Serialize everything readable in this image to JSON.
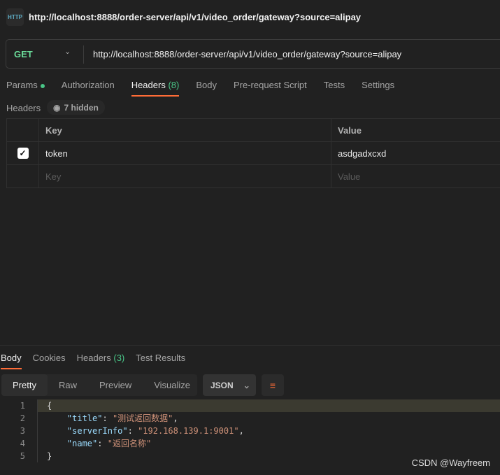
{
  "app": {
    "icon_text": "HTTP",
    "title": "http://localhost:8888/order-server/api/v1/video_order/gateway?source=alipay"
  },
  "request": {
    "method": "GET",
    "url": "http://localhost:8888/order-server/api/v1/video_order/gateway?source=alipay",
    "tabs": [
      {
        "label": "Params"
      },
      {
        "label": "Authorization"
      },
      {
        "label": "Headers",
        "count": "(8)"
      },
      {
        "label": "Body"
      },
      {
        "label": "Pre-request Script"
      },
      {
        "label": "Tests"
      },
      {
        "label": "Settings"
      }
    ],
    "headers_label": "Headers",
    "hidden_label": "7 hidden",
    "table": {
      "columns": [
        "Key",
        "Value"
      ],
      "rows": [
        {
          "checked": true,
          "key": "token",
          "value": "asdgadxcxd"
        }
      ],
      "placeholder": {
        "key": "Key",
        "value": "Value"
      }
    }
  },
  "response": {
    "tabs": [
      {
        "label": "Body"
      },
      {
        "label": "Cookies"
      },
      {
        "label": "Headers",
        "count": "(3)"
      },
      {
        "label": "Test Results"
      }
    ],
    "view_modes": [
      "Pretty",
      "Raw",
      "Preview",
      "Visualize"
    ],
    "format": "JSON",
    "lines": [
      {
        "n": "1",
        "parts": [
          [
            "p",
            "{"
          ]
        ]
      },
      {
        "n": "2",
        "parts": [
          [
            "p",
            "    "
          ],
          [
            "k",
            "\"title\""
          ],
          [
            "p",
            ": "
          ],
          [
            "s",
            "\"测试返回数据\""
          ],
          [
            "p",
            ","
          ]
        ]
      },
      {
        "n": "3",
        "parts": [
          [
            "p",
            "    "
          ],
          [
            "k",
            "\"serverInfo\""
          ],
          [
            "p",
            ": "
          ],
          [
            "s",
            "\"192.168.139.1:9001\""
          ],
          [
            "p",
            ","
          ]
        ]
      },
      {
        "n": "4",
        "parts": [
          [
            "p",
            "    "
          ],
          [
            "k",
            "\"name\""
          ],
          [
            "p",
            ": "
          ],
          [
            "s",
            "\"返回名称\""
          ]
        ]
      },
      {
        "n": "5",
        "parts": [
          [
            "p",
            "}"
          ]
        ]
      }
    ]
  },
  "watermark": "CSDN @Wayfreem",
  "colors": {
    "accent": "#ff6c37",
    "method": "#6bdd9a",
    "count": "#49c587"
  }
}
